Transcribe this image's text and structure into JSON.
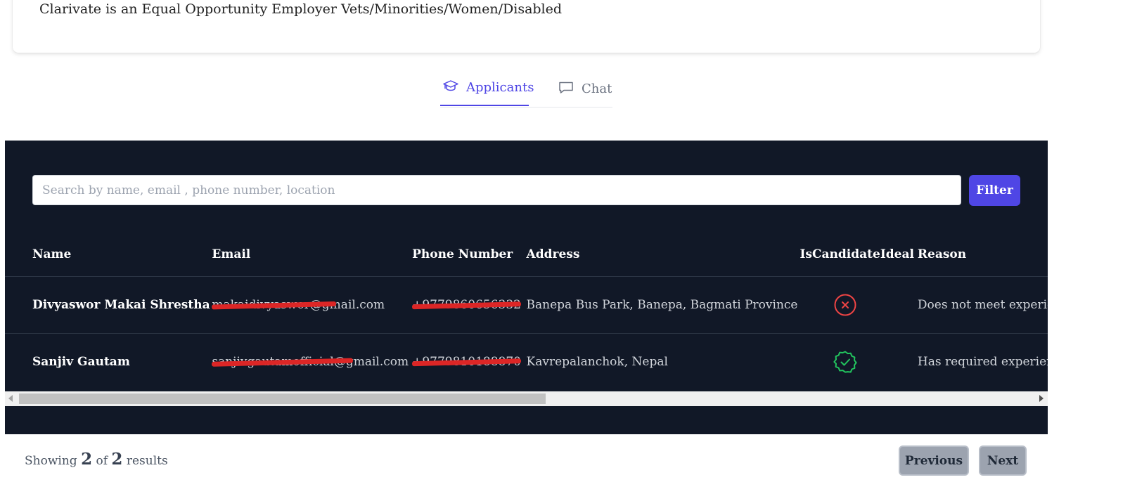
{
  "job": {
    "eeo_statement": "Clarivate is an Equal Opportunity Employer Vets/Minorities/Women/Disabled"
  },
  "tabs": [
    {
      "label": "Applicants",
      "icon": "graduation-cap-icon",
      "active": true
    },
    {
      "label": "Chat",
      "icon": "chat-bubble-icon",
      "active": false
    }
  ],
  "search": {
    "placeholder": "Search by name, email , phone number, location",
    "value": ""
  },
  "filter_label": "Filter",
  "table": {
    "headers": [
      "Name",
      "Email",
      "Phone Number",
      "Address",
      "IsCandidateIdeal",
      "Reason"
    ],
    "rows": [
      {
        "name": "Divyaswor Makai Shrestha",
        "email": "makaidivyaswor@gmail.com",
        "phone": "+9779860656332",
        "address": "Banepa Bus Park, Banepa, Bagmati Province",
        "ideal": false,
        "ideal_icon": "x-circle-icon",
        "reason": "Does not meet experience requirements"
      },
      {
        "name": "Sanjiv Gautam",
        "email": "sanjivgautamofficial@gmail.com",
        "phone": "+9779810188870",
        "address": "Kavrepalanchok, Nepal",
        "ideal": true,
        "ideal_icon": "check-badge-icon",
        "reason": "Has required experience and skills"
      }
    ]
  },
  "pagination": {
    "showing_prefix": "Showing",
    "showing_count": "2",
    "of_text": "of",
    "total": "2",
    "results_suffix": "results",
    "previous_label": "Previous",
    "next_label": "Next"
  },
  "colors": {
    "accent": "#4f46e5",
    "panel_bg": "#111827",
    "redaction": "#dc2626",
    "ideal_yes": "#22c55e",
    "ideal_no": "#ef4444"
  }
}
